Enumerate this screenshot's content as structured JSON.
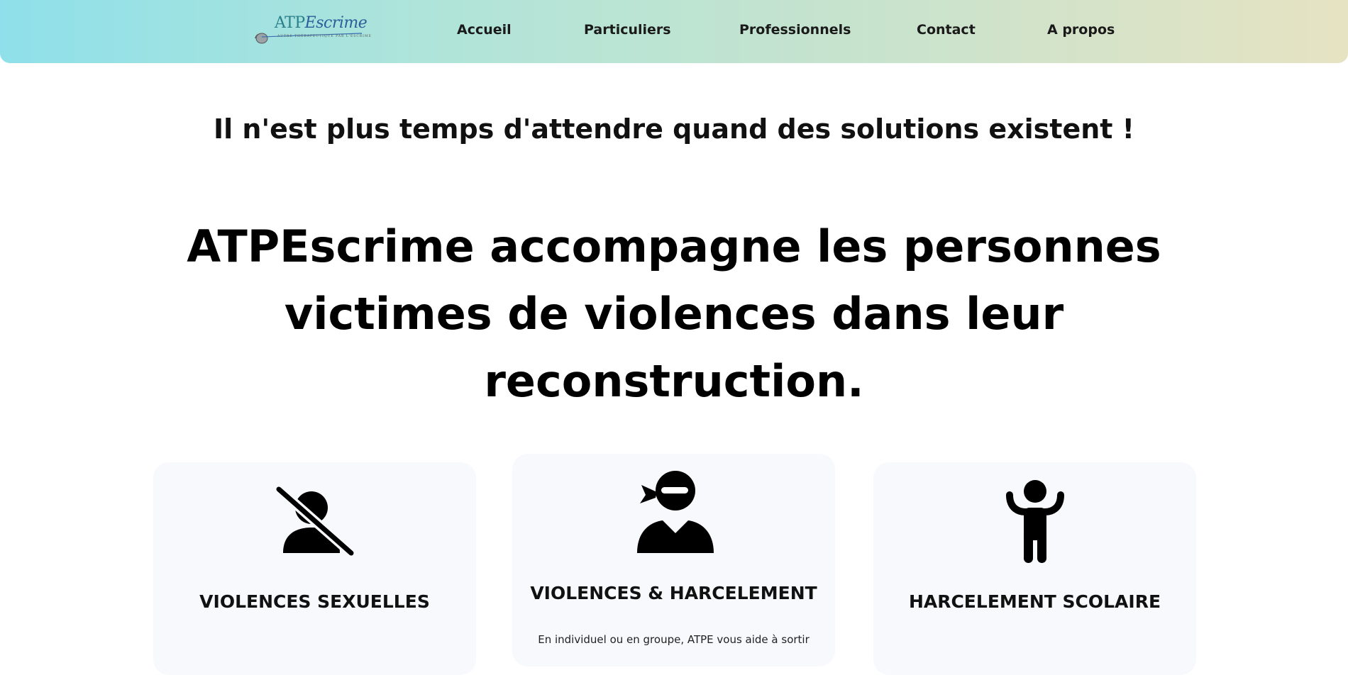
{
  "header": {
    "logo": {
      "brand": "ATP",
      "brand_script": "Escrime",
      "tagline": "Autre Thérapeutique par l'Escrime"
    },
    "nav": [
      "Accueil",
      "Particuliers",
      "Professionnels",
      "Contact",
      "A propos"
    ]
  },
  "main": {
    "tagline": "Il n'est plus temps d'attendre quand des solutions existent !",
    "headline_lines": [
      "ATPEscrime accompagne les personnes",
      "victimes de violences dans leur",
      "reconstruction."
    ],
    "cards": [
      {
        "title": "VIOLENCES SEXUELLES",
        "icon": "person-slash-icon"
      },
      {
        "title": "VIOLENCES & HARCELEMENT",
        "icon": "ninja-person-icon",
        "text": "En individuel ou en groupe, ATPE vous aide à sortir"
      },
      {
        "title": "HARCELEMENT SCOLAIRE",
        "icon": "child-icon"
      }
    ]
  }
}
